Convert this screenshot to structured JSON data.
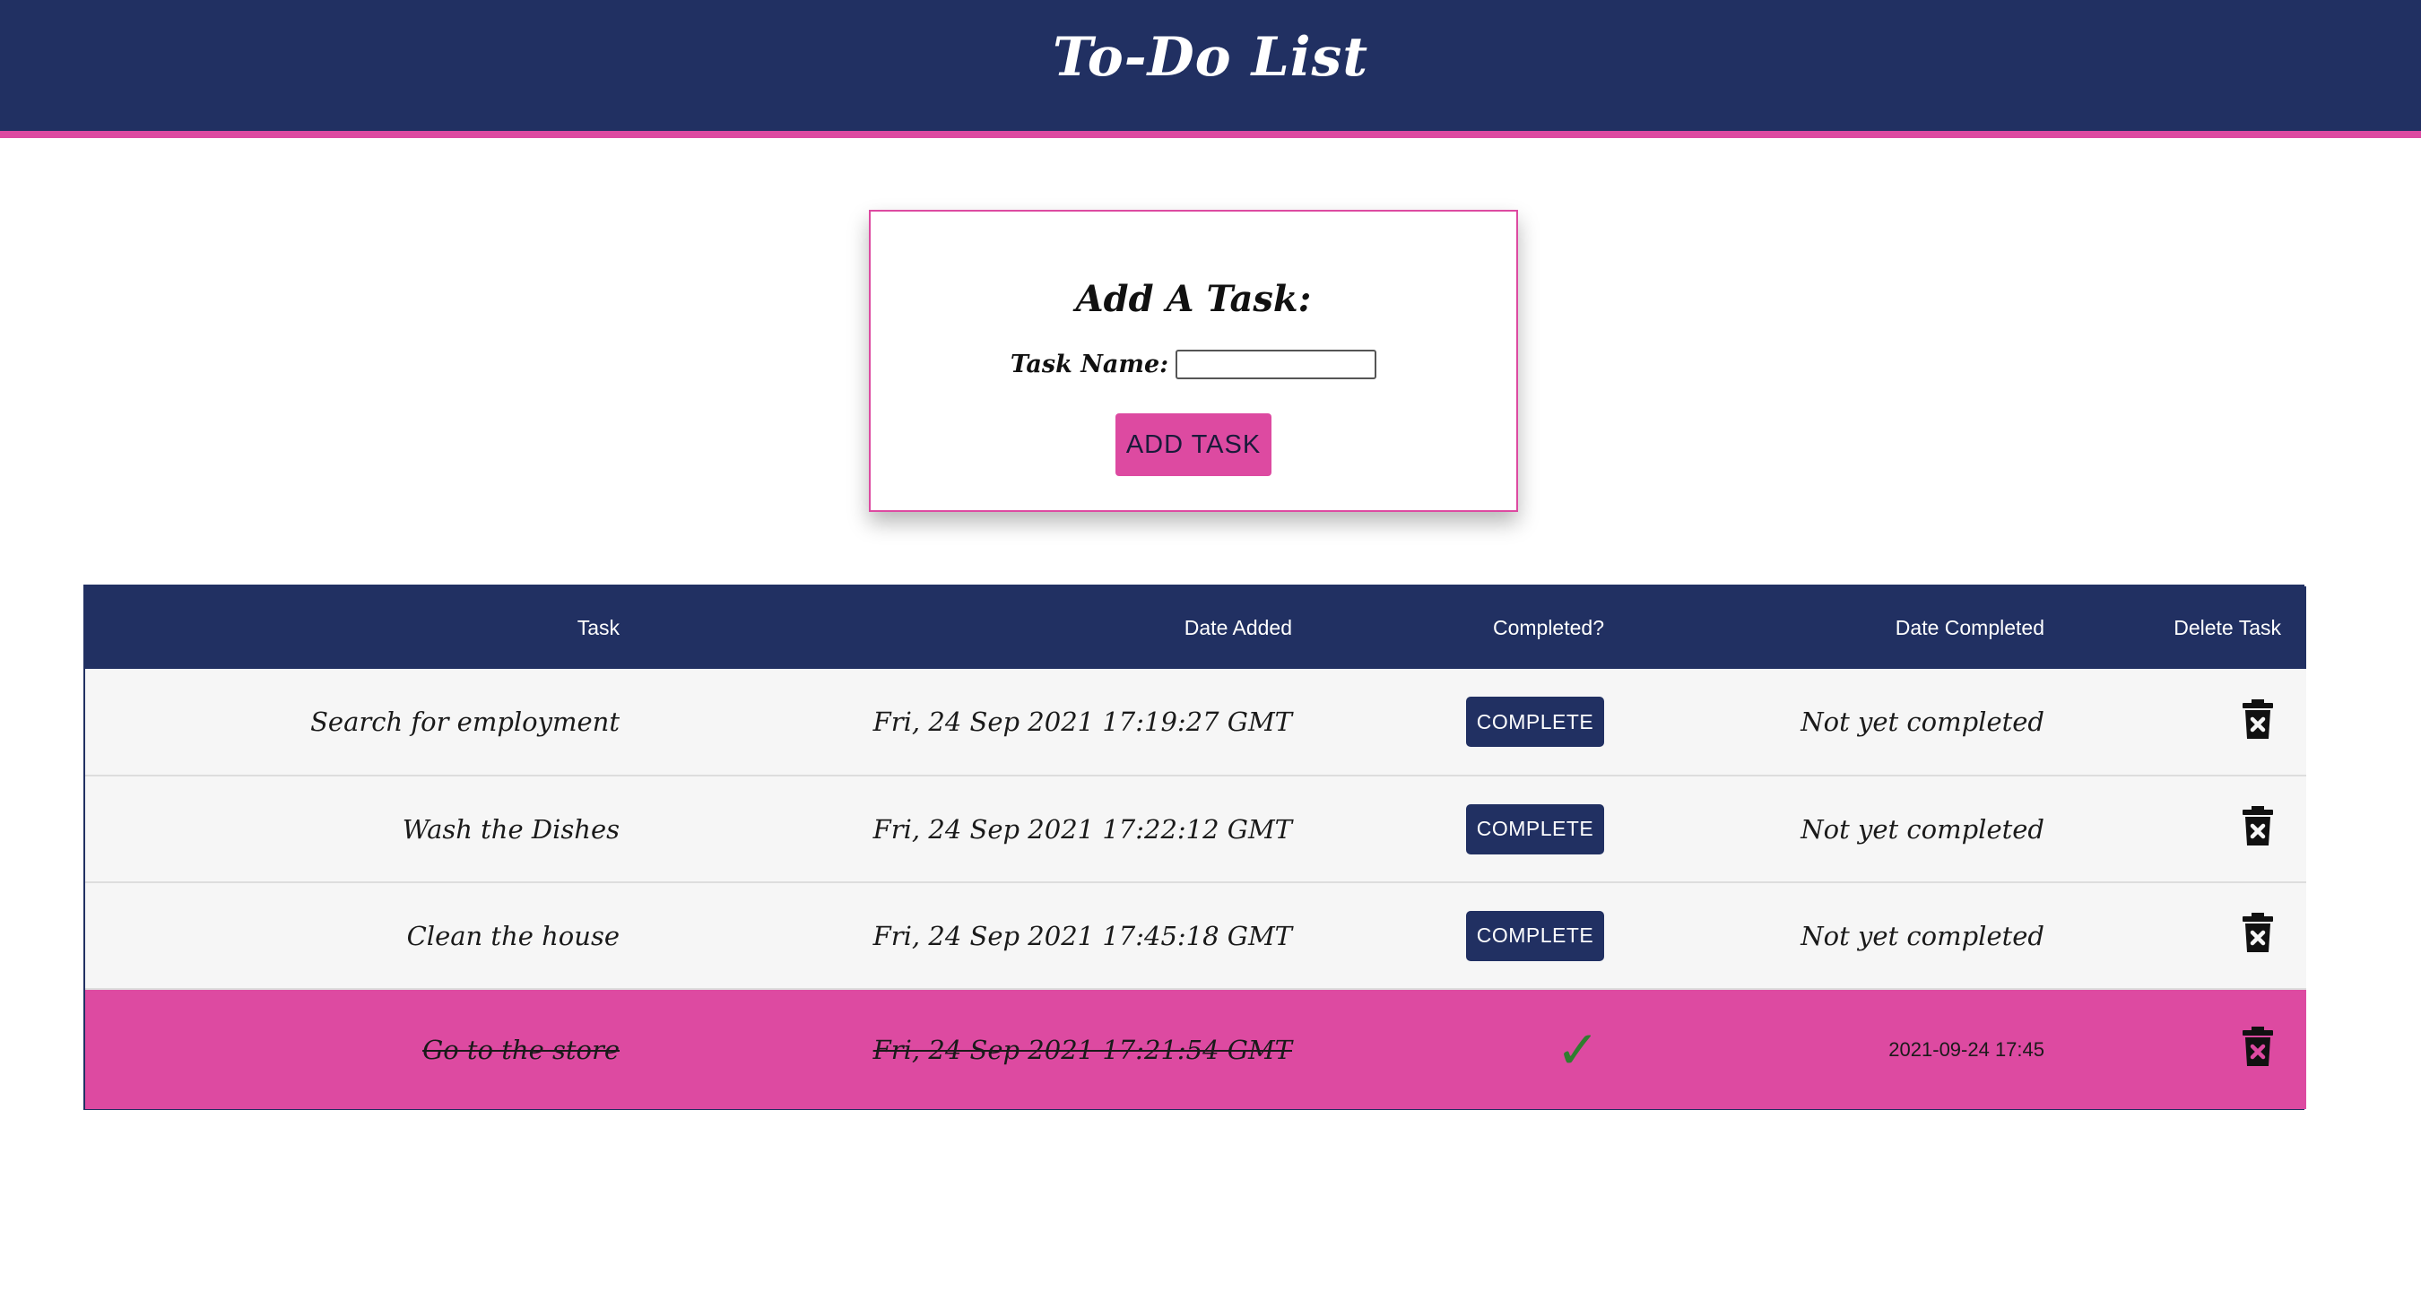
{
  "header": {
    "title": "To-Do List"
  },
  "form": {
    "title": "Add A Task:",
    "label": "Task Name:",
    "input_value": "",
    "input_placeholder": "",
    "button_label": "ADD TASK"
  },
  "table": {
    "headers": [
      "Task",
      "Date Added",
      "Completed?",
      "Date Completed",
      "Delete Task"
    ],
    "rows": [
      {
        "task": "Search for employment",
        "date_added": "Fri, 24 Sep 2021 17:19:27 GMT",
        "completed": false,
        "button": "COMPLETE",
        "date_completed": "Not yet completed"
      },
      {
        "task": "Wash the Dishes",
        "date_added": "Fri, 24 Sep 2021 17:22:12 GMT",
        "completed": false,
        "button": "COMPLETE",
        "date_completed": "Not yet completed"
      },
      {
        "task": "Clean the house",
        "date_added": "Fri, 24 Sep 2021 17:45:18 GMT",
        "completed": false,
        "button": "COMPLETE",
        "date_completed": "Not yet completed"
      },
      {
        "task": "Go to the store",
        "date_added": "Fri, 24 Sep 2021 17:21:54 GMT",
        "completed": true,
        "check": "✓",
        "date_completed": "2021-09-24 17:45"
      }
    ]
  },
  "icons": {
    "delete": "trash-icon",
    "done": "check-icon"
  },
  "colors": {
    "navy": "#213062",
    "pink": "#dd4aa1",
    "check_green": "#2f7d2f"
  }
}
